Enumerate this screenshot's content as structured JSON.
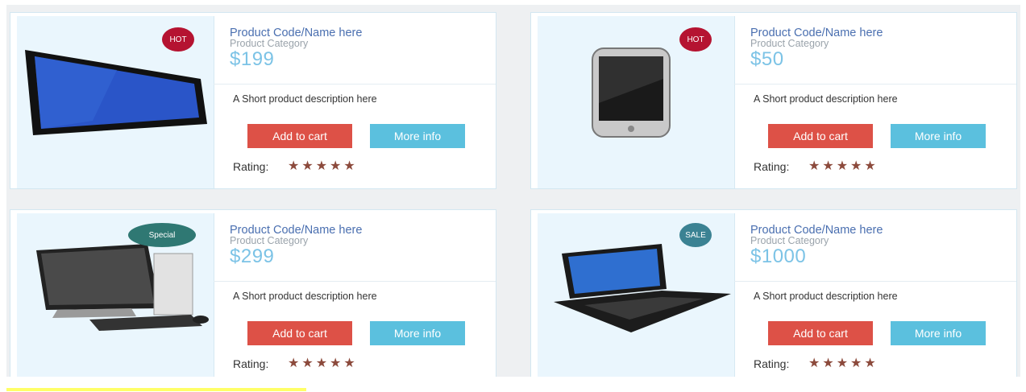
{
  "products": [
    {
      "title": "Product Code/Name here",
      "category": "Product Category",
      "price": "$199",
      "description": "A Short product description here",
      "add_to_cart": "Add to cart",
      "more_info": "More info",
      "rating_label": "Rating:",
      "rating": 5,
      "stars": "★★★★★",
      "badge": "HOT",
      "image": "tablet-image"
    },
    {
      "title": "Product Code/Name here",
      "category": "Product Category",
      "price": "$50",
      "description": "A Short product description here",
      "add_to_cart": "Add to cart",
      "more_info": "More info",
      "rating_label": "Rating:",
      "rating": 5,
      "stars": "★★★★★",
      "badge": "HOT",
      "image": "smartphone-image"
    },
    {
      "title": "Product Code/Name here",
      "category": "Product Category",
      "price": "$299",
      "description": "A Short product description here",
      "add_to_cart": "Add to cart",
      "more_info": "More info",
      "rating_label": "Rating:",
      "rating": 5,
      "stars": "★★★★★",
      "badge": "Special",
      "image": "desktop-computer-image"
    },
    {
      "title": "Product Code/Name here",
      "category": "Product Category",
      "price": "$1000",
      "description": "A Short product description here",
      "add_to_cart": "Add to cart",
      "more_info": "More info",
      "rating_label": "Rating:",
      "rating": 5,
      "stars": "★★★★★",
      "badge": "SALE",
      "image": "laptop-image"
    }
  ],
  "colors": {
    "cart_button": "#dd5147",
    "info_button": "#5bc0de",
    "price": "#7cc3e6",
    "title": "#4a6fb0",
    "badge_hot": "#b51331",
    "badge_sale": "#3b8293",
    "badge_special": "#2f7873",
    "star": "#8c4a3c"
  }
}
